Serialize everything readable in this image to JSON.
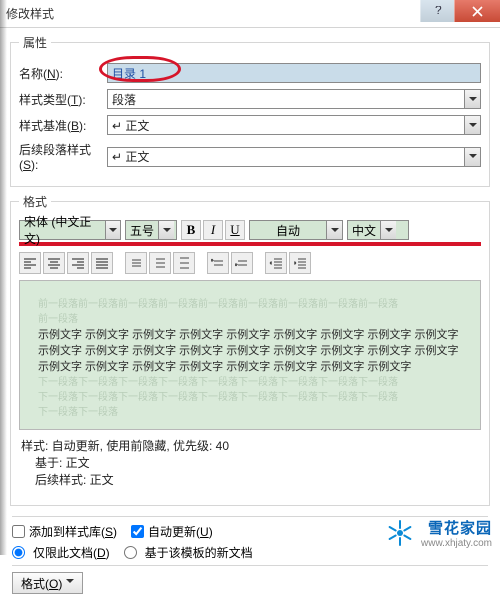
{
  "window": {
    "title": "修改样式"
  },
  "props": {
    "legend": "属性",
    "name": {
      "label_pre": "名称(",
      "hot": "N",
      "label_post": "):",
      "value": "目录 1"
    },
    "styleType": {
      "label_pre": "样式类型(",
      "hot": "T",
      "label_post": "):",
      "value": "段落"
    },
    "basedOn": {
      "label_pre": "样式基准(",
      "hot": "B",
      "label_post": "):",
      "value": "↵ 正文"
    },
    "nextStyle": {
      "label_pre": "后续段落样式(",
      "hot": "S",
      "label_post": "):",
      "value": "↵ 正文"
    }
  },
  "format": {
    "legend": "格式",
    "font": "宋体 (中文正文)",
    "size": "五号",
    "color": "自动",
    "lang": "中文"
  },
  "preview": {
    "faint_before_1": "前一段落前一段落前一段落前一段落前一段落前一段落前一段落前一段落前一段落",
    "faint_before_2": "前一段落",
    "line1": "示例文字 示例文字 示例文字 示例文字 示例文字 示例文字 示例文字 示例文字 示例文字",
    "line2": "示例文字 示例文字 示例文字 示例文字 示例文字 示例文字 示例文字 示例文字 示例文字",
    "line3": "示例文字 示例文字 示例文字 示例文字 示例文字 示例文字 示例文字 示例文字",
    "faint_after_1": "下一段落下一段落下一段落下一段落下一段落下一段落下一段落下一段落下一段落",
    "faint_after_2": "下一段落下一段落下一段落下一段落下一段落下一段落下一段落下一段落下一段落",
    "faint_after_3": "下一段落下一段落"
  },
  "desc": {
    "l1": "样式: 自动更新, 使用前隐藏, 优先级: 40",
    "l2": "基于: 正文",
    "l3": "后续样式: 正文"
  },
  "checks": {
    "addToGallery_pre": "添加到样式库(",
    "addToGallery_hot": "S",
    "addToGallery_post": ")",
    "autoUpdate_pre": "自动更新(",
    "autoUpdate_hot": "U",
    "autoUpdate_post": ")",
    "thisDoc_pre": "仅限此文档(",
    "thisDoc_hot": "D",
    "thisDoc_post": ")",
    "template": "基于该模板的新文档"
  },
  "footer": {
    "formatBtn_pre": "格式(",
    "formatBtn_hot": "O",
    "formatBtn_post": ")"
  },
  "watermark": {
    "brand": "雪花家园",
    "url": "www.xhjaty.com"
  }
}
